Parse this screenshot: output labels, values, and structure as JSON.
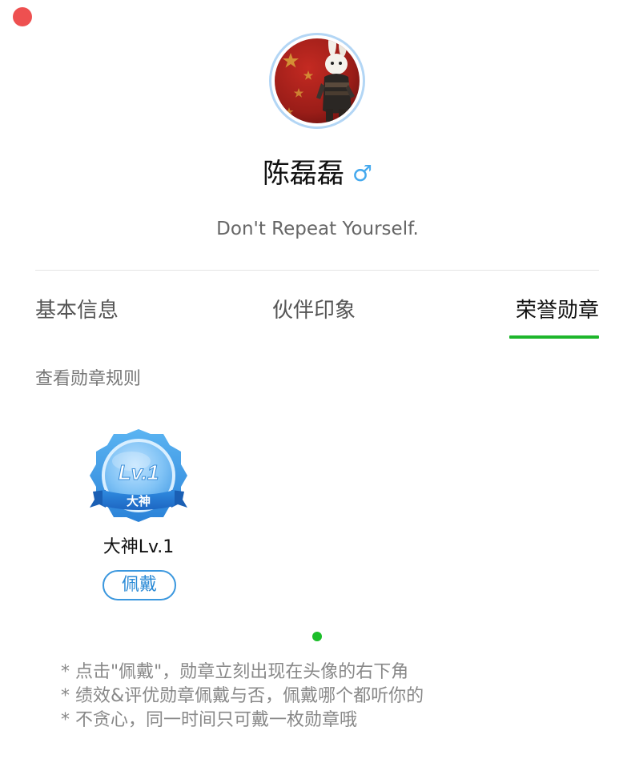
{
  "profile": {
    "name": "陈磊磊",
    "gender_symbol": "♂",
    "motto": "Don't Repeat Yourself."
  },
  "tabs": [
    {
      "label": "基本信息",
      "active": false
    },
    {
      "label": "伙伴印象",
      "active": false
    },
    {
      "label": "荣誉勋章",
      "active": true
    }
  ],
  "rules_link": "查看勋章规则",
  "medal": {
    "badge_level": "Lv.1",
    "badge_ribbon": "大神",
    "name": "大神Lv.1",
    "wear_label": "佩戴"
  },
  "tips": [
    "* 点击\"佩戴\"，勋章立刻出现在头像的右下角",
    "* 绩效&评优勋章佩戴与否，佩戴哪个都听你的",
    "* 不贪心，同一时间只可戴一枚勋章哦"
  ],
  "colors": {
    "accent_green": "#1db62b",
    "accent_blue": "#3a97de",
    "close_red": "#ee5050"
  }
}
